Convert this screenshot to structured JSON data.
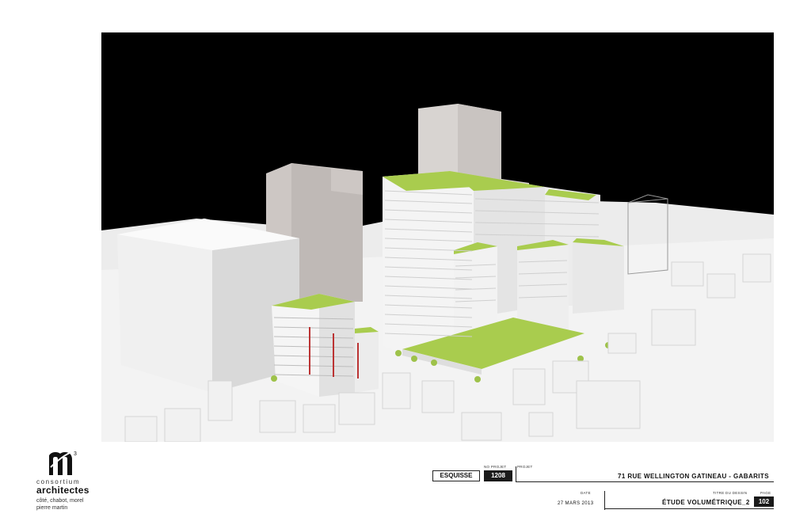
{
  "logo": {
    "mark": "m",
    "superscript": "3",
    "subtitle": "consortium",
    "name": "architectes",
    "partners": [
      "côté, chabot, morel",
      "pierre martin"
    ]
  },
  "titleblock": {
    "phase": "ESQUISSE",
    "project_no_label": "NO PROJET",
    "project_no": "1208",
    "project_label": "PROJET",
    "project": "71 RUE WELLINGTON GATINEAU - GABARITS",
    "date_label": "DATE",
    "date": "27 MARS 2013",
    "drawing_title_label": "TITRE DU DESSIN",
    "drawing_title": "ÉTUDE VOLUMÉTRIQUE_2",
    "page_label": "PAGE",
    "page": "102"
  },
  "colors": {
    "sky": "#000000",
    "massing": "#e9e9e9",
    "existing_tower": "#cfcac7",
    "green_roof": "#a9cc4e",
    "trim": "#1a1a1a"
  }
}
